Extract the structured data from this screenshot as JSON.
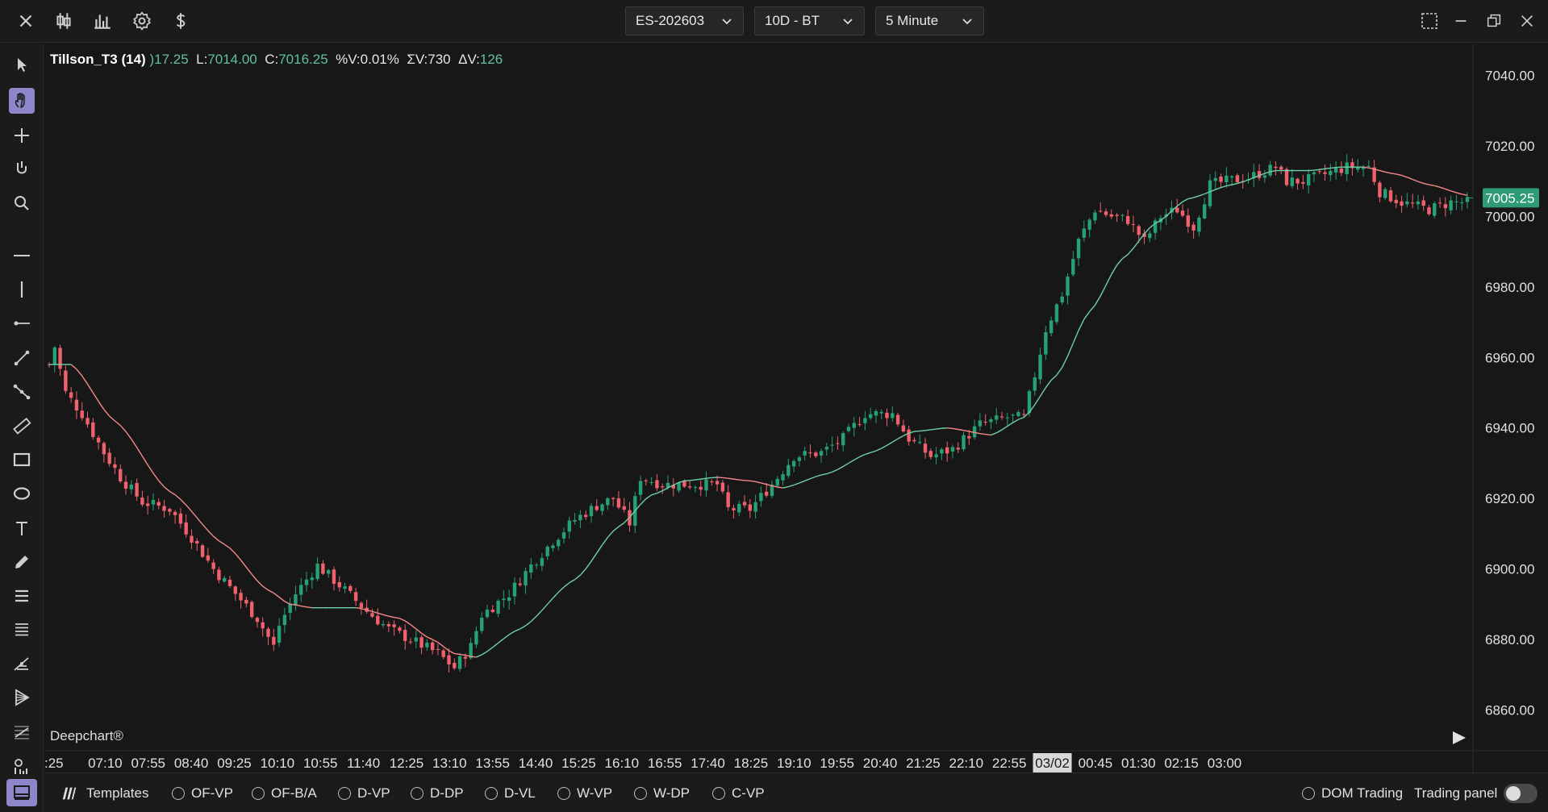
{
  "toolbar": {
    "symbol": "ES-202603",
    "period": "10D - BT",
    "interval": "5 Minute",
    "icons": [
      "close-icon",
      "candlestick-icon",
      "bar-chart-icon",
      "settings-gear-icon",
      "dollar-icon"
    ],
    "window_icons": [
      "layout-icon",
      "minimize-icon",
      "restore-icon",
      "close-icon"
    ]
  },
  "left_tools": [
    "pointer-icon",
    "hand-icon",
    "crosshair-icon",
    "magnet-icon",
    "zoom-icon",
    "horizontal-line-icon",
    "vertical-line-icon",
    "horizontal-ray-icon",
    "trend-line-icon",
    "polyline-icon",
    "ruler-icon",
    "rectangle-icon",
    "ellipse-icon",
    "text-icon",
    "pencil-icon",
    "fib-retracement-icon",
    "fib-extension-icon",
    "pitchfork-icon",
    "gann-icon",
    "regression-icon",
    "volume-profile-icon"
  ],
  "legend": {
    "indicator": "Tillson_T3 (14)",
    "h_partial": ")17.25",
    "l_label": "L:",
    "l_value": "7014.00",
    "c_label": "C:",
    "c_value": "7016.25",
    "pv_label": "%V:",
    "pv_value": "0.01%",
    "sv_label": "ΣV:",
    "sv_value": "730",
    "dv_label": "ΔV:",
    "dv_value": "126"
  },
  "brand": "Deepchart®",
  "colors": {
    "up": "#26a176",
    "down": "#f0616d",
    "t3_up": "#6ecfa8",
    "t3_down": "#f48a8a",
    "accent": "#8d86c9",
    "price_tag": "#2f9b74"
  },
  "chart_data": {
    "type": "candlestick",
    "y_axis_labels": [
      "7040.00",
      "7020.00",
      "7000.00",
      "6980.00",
      "6960.00",
      "6940.00",
      "6920.00",
      "6900.00",
      "6880.00",
      "6860.00"
    ],
    "ylim": [
      6856,
      7044
    ],
    "current_price": "7005.25",
    "x_axis_labels": [
      ":25",
      "07:10",
      "07:55",
      "08:40",
      "09:25",
      "10:10",
      "10:55",
      "11:40",
      "12:25",
      "13:10",
      "13:55",
      "14:40",
      "15:25",
      "16:10",
      "16:55",
      "17:40",
      "18:25",
      "19:10",
      "19:55",
      "20:40",
      "21:25",
      "22:10",
      "22:55",
      "03/02",
      "00:45",
      "01:30",
      "02:15",
      "03:00"
    ],
    "highlighted_x_label": "03/02",
    "price_anchors": [
      [
        0,
        6958
      ],
      [
        1,
        6963
      ],
      [
        3,
        6950
      ],
      [
        6,
        6944
      ],
      [
        10,
        6933
      ],
      [
        13,
        6926
      ],
      [
        17,
        6919
      ],
      [
        22,
        6917
      ],
      [
        26,
        6909
      ],
      [
        30,
        6900
      ],
      [
        34,
        6893
      ],
      [
        38,
        6886
      ],
      [
        41,
        6878
      ],
      [
        42,
        6884
      ],
      [
        45,
        6893
      ],
      [
        49,
        6901
      ],
      [
        54,
        6894
      ],
      [
        58,
        6888
      ],
      [
        62,
        6883
      ],
      [
        66,
        6880
      ],
      [
        71,
        6876
      ],
      [
        74,
        6872
      ],
      [
        77,
        6878
      ],
      [
        79,
        6887
      ],
      [
        84,
        6893
      ],
      [
        88,
        6901
      ],
      [
        92,
        6908
      ],
      [
        96,
        6914
      ],
      [
        100,
        6918
      ],
      [
        103,
        6920
      ],
      [
        106,
        6913
      ],
      [
        108,
        6926
      ],
      [
        112,
        6924
      ],
      [
        116,
        6924
      ],
      [
        122,
        6924
      ],
      [
        124,
        6917
      ],
      [
        128,
        6917
      ],
      [
        132,
        6924
      ],
      [
        136,
        6932
      ],
      [
        141,
        6933
      ],
      [
        145,
        6937
      ],
      [
        149,
        6944
      ],
      [
        154,
        6944
      ],
      [
        157,
        6937
      ],
      [
        161,
        6932
      ],
      [
        165,
        6934
      ],
      [
        170,
        6941
      ],
      [
        175,
        6943
      ],
      [
        178,
        6943
      ],
      [
        180,
        6955
      ],
      [
        182,
        6968
      ],
      [
        185,
        6978
      ],
      [
        188,
        6993
      ],
      [
        191,
        7002
      ],
      [
        194,
        7000
      ],
      [
        197,
        6999
      ],
      [
        200,
        6993
      ],
      [
        203,
        7000
      ],
      [
        206,
        7002
      ],
      [
        209,
        6997
      ],
      [
        212,
        7009
      ],
      [
        215,
        7010
      ],
      [
        219,
        7011
      ],
      [
        224,
        7014
      ],
      [
        226,
        7010
      ],
      [
        229,
        7010
      ],
      [
        233,
        7012
      ],
      [
        237,
        7014
      ],
      [
        241,
        7014
      ],
      [
        243,
        7007
      ],
      [
        247,
        7004
      ],
      [
        252,
        7002
      ],
      [
        256,
        7004
      ],
      [
        259,
        7004
      ]
    ],
    "t3_anchors": [
      [
        0,
        6958
      ],
      [
        4,
        6958
      ],
      [
        12,
        6942
      ],
      [
        22,
        6922
      ],
      [
        32,
        6907
      ],
      [
        40,
        6894
      ],
      [
        44,
        6890
      ],
      [
        48,
        6889
      ],
      [
        56,
        6889
      ],
      [
        64,
        6886
      ],
      [
        70,
        6880
      ],
      [
        74,
        6876
      ],
      [
        78,
        6875
      ],
      [
        86,
        6883
      ],
      [
        96,
        6897
      ],
      [
        104,
        6912
      ],
      [
        110,
        6921
      ],
      [
        116,
        6925
      ],
      [
        122,
        6926
      ],
      [
        128,
        6925
      ],
      [
        134,
        6923
      ],
      [
        142,
        6927
      ],
      [
        150,
        6933
      ],
      [
        158,
        6939
      ],
      [
        164,
        6940
      ],
      [
        172,
        6938
      ],
      [
        178,
        6943
      ],
      [
        184,
        6955
      ],
      [
        190,
        6973
      ],
      [
        196,
        6988
      ],
      [
        202,
        6998
      ],
      [
        208,
        7005
      ],
      [
        216,
        7009
      ],
      [
        224,
        7013
      ],
      [
        230,
        7013
      ],
      [
        236,
        7014
      ],
      [
        240,
        7014
      ],
      [
        246,
        7012
      ],
      [
        252,
        7009
      ],
      [
        259,
        7006
      ]
    ]
  },
  "bottombar": {
    "templates_label": "Templates",
    "radios": [
      "OF-VP",
      "OF-B/A",
      "D-VP",
      "D-DP",
      "D-VL",
      "W-VP",
      "W-DP",
      "C-VP"
    ],
    "dom_label": "DOM Trading",
    "panel_label": "Trading panel"
  }
}
